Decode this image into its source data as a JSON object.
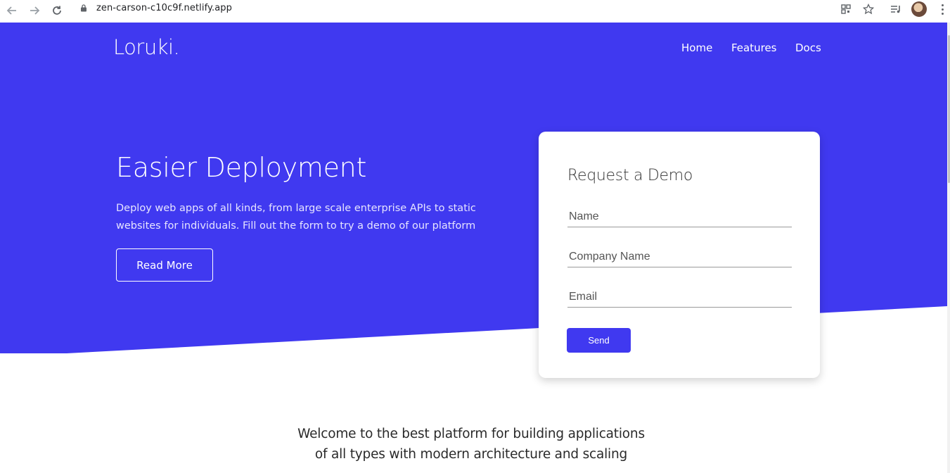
{
  "browser": {
    "url": "zen-carson-c10c9f.netlify.app",
    "back_icon": "arrow-left-icon",
    "forward_icon": "arrow-right-icon",
    "reload_icon": "reload-icon"
  },
  "site": {
    "logo": "Loruki.",
    "nav": [
      "Home",
      "Features",
      "Docs"
    ],
    "brand_color": "#4039f0"
  },
  "hero": {
    "title": "Easier Deployment",
    "text": "Deploy web apps of all kinds, from large scale enterprise APIs to static websites for individuals. Fill out the form to try a demo of our platform",
    "button": "Read More"
  },
  "demo_form": {
    "title": "Request a Demo",
    "name_placeholder": "Name",
    "company_placeholder": "Company Name",
    "email_placeholder": "Email",
    "send": "Send"
  },
  "intro": {
    "text": "Welcome to the best platform for building applications of all types with modern architecture and scaling"
  }
}
